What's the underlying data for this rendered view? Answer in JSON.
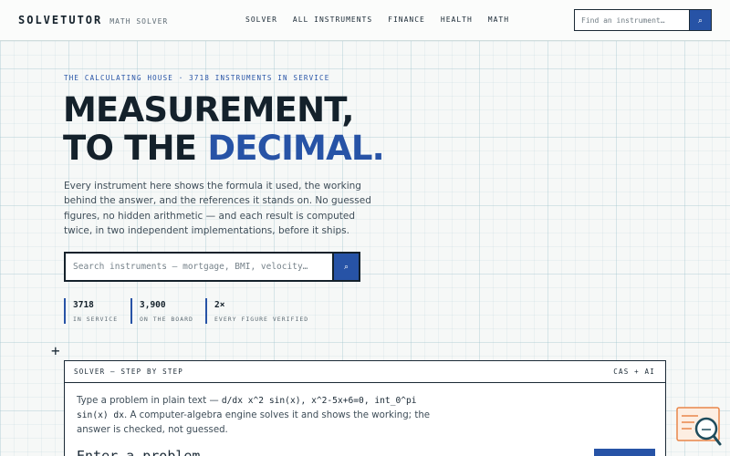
{
  "header": {
    "brand": "SOLVETUTOR",
    "brand_subtitle": "MATH SOLVER",
    "nav": [
      "SOLVER",
      "ALL INSTRUMENTS",
      "FINANCE",
      "HEALTH",
      "MATH"
    ],
    "search_placeholder": "Find an instrument…",
    "search_icon": "⌕"
  },
  "hero": {
    "eyebrow": "THE CALCULATING HOUSE · 3718 INSTRUMENTS IN SERVICE",
    "headline_line1": "MEASUREMENT,",
    "headline_line2_prefix": "TO THE ",
    "headline_line2_accent": "DECIMAL.",
    "intro": "Every instrument here shows the formula it used, the working behind the answer, and the references it stands on. No guessed figures, no hidden arithmetic — and each result is computed twice, in two independent implementations, before it ships.",
    "search_placeholder": "Search instruments — mortgage, BMI, velocity…",
    "search_icon": "⌕"
  },
  "stats": [
    {
      "value": "3718",
      "label": "IN SERVICE"
    },
    {
      "value": "3,900",
      "label": "ON THE BOARD"
    },
    {
      "value": "2×",
      "label": "EVERY FIGURE VERIFIED"
    }
  ],
  "solver": {
    "title": "SOLVER — STEP BY STEP",
    "tag": "CAS + AI",
    "desc_before": "Type a problem in plain text — ",
    "examples": "d/dx x^2 sin(x), x^2-5x+6=0, int_0^pi sin(x) dx",
    "desc_after": ". A computer-algebra engine solves it and shows the working; the answer is checked, not guessed.",
    "input_partial": "Enter a problem…"
  },
  "colors": {
    "accent": "#2753a6",
    "ink": "#14212b",
    "background": "#f6f8f7"
  },
  "icons": {
    "plus_marker": "+",
    "badge": "chat-search-badge"
  }
}
